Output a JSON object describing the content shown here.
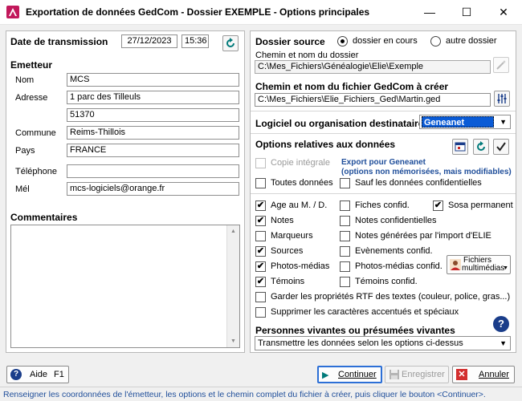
{
  "window": {
    "title": "Exportation de données GedCom - Dossier EXEMPLE - Options principales",
    "minimize": "—",
    "maximize": "☐",
    "close": "✕"
  },
  "left": {
    "date_label": "Date de transmission",
    "date_value": "27/12/2023",
    "time_value": "15:36",
    "emitter_heading": "Emetteur",
    "nom_label": "Nom",
    "nom_value": "MCS",
    "adresse_label": "Adresse",
    "adresse_line1": "1 parc des Tilleuls",
    "adresse_line2": "51370",
    "commune_label": "Commune",
    "commune_value": "Reims-Thillois",
    "pays_label": "Pays",
    "pays_value": "FRANCE",
    "telephone_label": "Téléphone",
    "telephone_value": "",
    "mel_label": "Mél",
    "mel_value": "mcs-logiciels@orange.fr",
    "comments_heading": "Commentaires",
    "comments_value": ""
  },
  "right": {
    "source_label": "Dossier source",
    "radio_current": "dossier en cours",
    "radio_other": "autre dossier",
    "source_path_label": "Chemin et nom du dossier",
    "source_path_value": "C:\\Mes_Fichiers\\Généalogie\\Elie\\Exemple",
    "gedcom_path_label": "Chemin et nom du fichier GedCom à créer",
    "gedcom_path_value": "C:\\Mes_Fichiers\\Elie_Fichiers_Ged\\Martin.ged",
    "software_label": "Logiciel ou organisation destinataire",
    "software_value": "Geneanet",
    "options_heading": "Options relatives aux données",
    "copie_integrale": "Copie intégrale",
    "export_note_line1": "Export pour Geneanet",
    "export_note_line2": "(options non mémorisées, mais modifiables)",
    "toutes_donnees": "Toutes données",
    "sauf_confidentielles": "Sauf les données confidentielles",
    "options": {
      "age": "Age au M. / D.",
      "fiches_confid": "Fiches confid.",
      "sosa": "Sosa permanent",
      "notes": "Notes",
      "notes_confid": "Notes confidentielles",
      "marqueurs": "Marqueurs",
      "notes_generees": "Notes générées par l'import d'ELIE",
      "sources": "Sources",
      "evenements_confid": "Evènements confid.",
      "photos": "Photos-médias",
      "photos_confid": "Photos-médias confid.",
      "temoins": "Témoins",
      "temoins_confid": "Témoins confid.",
      "garder_rtf": "Garder les propriétés RTF des textes (couleur, police, gras...)",
      "supprimer_accents": "Supprimer les caractères accentués et spéciaux"
    },
    "media_button_line1": "Fichiers",
    "media_button_line2": "multimédias",
    "living_heading": "Personnes vivantes ou présumées vivantes",
    "living_value": "Transmettre les données selon les options ci-dessus"
  },
  "buttons": {
    "aide": "Aide",
    "aide_key": "F1",
    "continuer": "Continuer",
    "enregistrer": "Enregistrer",
    "annuler": "Annuler"
  },
  "status": "Renseigner les coordonnées de l'émetteur, les options et le chemin complet du fichier à créer, puis cliquer le bouton <Continuer>.",
  "colors": {
    "accent_blue": "#1f4e9a",
    "status_blue": "#1f4e9a",
    "checked_green": "#2e7d32"
  }
}
